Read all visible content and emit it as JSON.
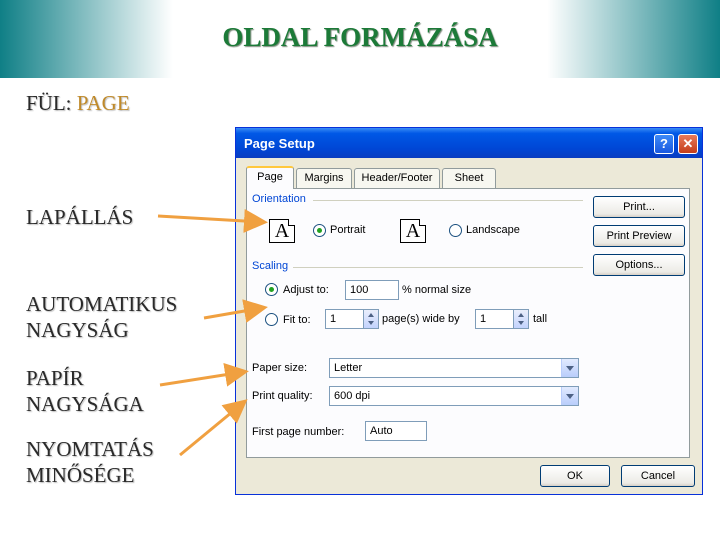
{
  "slide": {
    "title": "OLDAL FORMÁZÁSA",
    "tab_caption_prefix": "FÜL:",
    "tab_caption_value": "PAGE",
    "labels": {
      "orientation": "LAPÁLLÁS",
      "auto_size_line1": "AUTOMATIKUS",
      "auto_size_line2": "NAGYSÁG",
      "paper_size_line1": "PAPÍR",
      "paper_size_line2": "NAGYSÁGA",
      "print_quality_line1": "NYOMTATÁS",
      "print_quality_line2": "MINŐSÉGE"
    },
    "arrow_color": "#f0a040",
    "accent_color": "#c08a2a",
    "title_color": "#1c7a38"
  },
  "dialog": {
    "title": "Page Setup",
    "help_glyph": "?",
    "close_glyph": "✕",
    "tabs": [
      {
        "label": "Page",
        "active": true
      },
      {
        "label": "Margins",
        "active": false
      },
      {
        "label": "Header/Footer",
        "active": false
      },
      {
        "label": "Sheet",
        "active": false
      }
    ],
    "orientation": {
      "section_label": "Orientation",
      "portrait_label": "Portrait",
      "portrait_checked": true,
      "landscape_label": "Landscape",
      "landscape_checked": false,
      "icon_letter": "A"
    },
    "scaling": {
      "section_label": "Scaling",
      "adjust_label": "Adjust to:",
      "adjust_checked": true,
      "adjust_value": "100",
      "adjust_suffix": "% normal size",
      "fit_label": "Fit to:",
      "fit_checked": false,
      "fit_wide_value": "1",
      "fit_wide_suffix": "page(s) wide by",
      "fit_tall_value": "1",
      "fit_tall_suffix": "tall"
    },
    "paper_size": {
      "label": "Paper size:",
      "value": "Letter"
    },
    "print_quality": {
      "label": "Print quality:",
      "value": "600 dpi"
    },
    "first_page_number": {
      "label": "First page number:",
      "value": "Auto"
    },
    "buttons": {
      "print": "Print...",
      "print_preview": "Print Preview",
      "options": "Options...",
      "ok": "OK",
      "cancel": "Cancel"
    }
  }
}
